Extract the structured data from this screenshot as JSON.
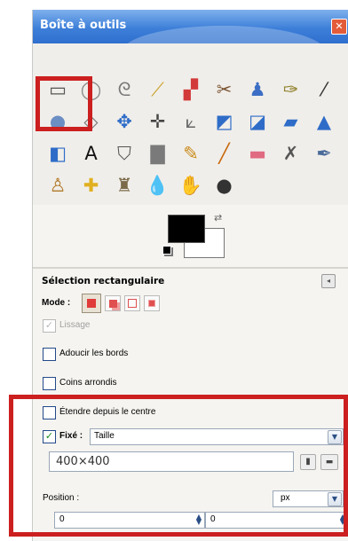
{
  "window": {
    "title": "Boîte à outils"
  },
  "toolbox": {
    "tools": [
      {
        "name": "rect-select-icon",
        "glyph": "▭",
        "color": "#555555"
      },
      {
        "name": "ellipse-select-icon",
        "glyph": "◯",
        "color": "#888888"
      },
      {
        "name": "free-select-icon",
        "glyph": "ᘓ",
        "color": "#777777"
      },
      {
        "name": "fuzzy-select-icon",
        "glyph": "⟋",
        "color": "#c9a227"
      },
      {
        "name": "color-select-icon",
        "glyph": "▞",
        "color": "#d23a3a"
      },
      {
        "name": "scissors-icon",
        "glyph": "✂",
        "color": "#7a5230"
      },
      {
        "name": "foreground-select-icon",
        "glyph": "♟",
        "color": "#3b6ec4"
      },
      {
        "name": "paths-icon",
        "glyph": "✑",
        "color": "#8a7a20"
      },
      {
        "name": "color-picker-icon",
        "glyph": "⁄",
        "color": "#333333"
      },
      {
        "name": "zoom-icon",
        "glyph": "●",
        "color": "#6b8ec4"
      },
      {
        "name": "measure-icon",
        "glyph": "◇",
        "color": "#777777"
      },
      {
        "name": "move-icon",
        "glyph": "✥",
        "color": "#2e6cc8"
      },
      {
        "name": "align-icon",
        "glyph": "✛",
        "color": "#444444"
      },
      {
        "name": "crop-icon",
        "glyph": "⟀",
        "color": "#666666"
      },
      {
        "name": "rotate-icon",
        "glyph": "◩",
        "color": "#2e6cc8"
      },
      {
        "name": "scale-icon",
        "glyph": "◪",
        "color": "#2e6cc8"
      },
      {
        "name": "shear-icon",
        "glyph": "▰",
        "color": "#2e6cc8"
      },
      {
        "name": "perspective-icon",
        "glyph": "▲",
        "color": "#2e6cc8"
      },
      {
        "name": "flip-icon",
        "glyph": "◧",
        "color": "#2e6cc8"
      },
      {
        "name": "text-icon",
        "glyph": "A",
        "color": "#111111"
      },
      {
        "name": "bucket-fill-icon",
        "glyph": "⛉",
        "color": "#555555"
      },
      {
        "name": "blend-icon",
        "glyph": "▇",
        "color": "#7a7a7a"
      },
      {
        "name": "pencil-icon",
        "glyph": "✎",
        "color": "#c98a1a"
      },
      {
        "name": "paintbrush-icon",
        "glyph": "╱",
        "color": "#c76a10"
      },
      {
        "name": "eraser-icon",
        "glyph": "▬",
        "color": "#e06a80"
      },
      {
        "name": "airbrush-icon",
        "glyph": "✗",
        "color": "#555555"
      },
      {
        "name": "ink-icon",
        "glyph": "✒",
        "color": "#4a6a9a"
      },
      {
        "name": "clone-icon",
        "glyph": "♙",
        "color": "#b07a2a"
      },
      {
        "name": "heal-icon",
        "glyph": "✚",
        "color": "#e0b020"
      },
      {
        "name": "perspective-clone-icon",
        "glyph": "♜",
        "color": "#7a6a4a"
      },
      {
        "name": "blur-icon",
        "glyph": "💧",
        "color": "#5a8ac4"
      },
      {
        "name": "smudge-icon",
        "glyph": "✋",
        "color": "#c98a40"
      },
      {
        "name": "dodge-burn-icon",
        "glyph": "●",
        "color": "#333333"
      }
    ]
  },
  "tool_options": {
    "title": "Sélection rectangulaire",
    "mode_label": "Mode :",
    "antialias_label": "Lissage",
    "feather_label": "Adoucir les bords",
    "rounded_label": "Coins arrondis",
    "expand_label": "Étendre depuis le centre",
    "fixed_label": "Fixé :",
    "fixed_option": "Taille",
    "size_value": "400×400",
    "position_label": "Position :",
    "unit_value": "px",
    "position_x": "0",
    "position_y": "0"
  },
  "colors": {
    "accent": "#cc1f1f",
    "titlebar": "#3d7fd9"
  }
}
